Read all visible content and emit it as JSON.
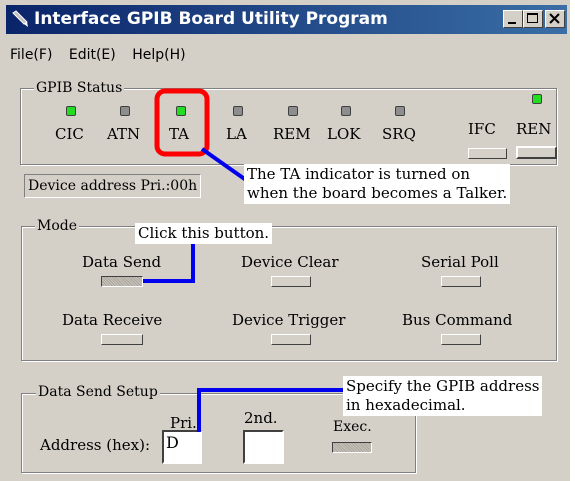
{
  "window": {
    "title": "Interface GPIB Board Utility Program",
    "icon": "pen-icon"
  },
  "menu": [
    "File(F)",
    "Edit(E)",
    "Help(H)"
  ],
  "gpib_status": {
    "title": "GPIB Status",
    "indicators": [
      {
        "label": "CIC",
        "state": "on"
      },
      {
        "label": "ATN",
        "state": "off"
      },
      {
        "label": "TA",
        "state": "on"
      },
      {
        "label": "LA",
        "state": "off"
      },
      {
        "label": "REM",
        "state": "off"
      },
      {
        "label": "LOK",
        "state": "off"
      },
      {
        "label": "SRQ",
        "state": "off"
      },
      {
        "label": "REN",
        "state": "on"
      }
    ],
    "buttons": {
      "ifc": "IFC",
      "ren": "REN"
    }
  },
  "device_address": "Device address Pri.:00h",
  "mode": {
    "title": "Mode",
    "buttons": [
      "Data Send",
      "Device Clear",
      "Serial Poll",
      "Data Receive",
      "Device Trigger",
      "Bus Command"
    ]
  },
  "data_send_setup": {
    "title": "Data Send Setup",
    "pri_label": "Pri.",
    "second_label": "2nd.",
    "exec_label": "Exec.",
    "address_label": "Address (hex):",
    "pri_value": "D",
    "second_value": ""
  },
  "callouts": {
    "ta_line1": "The TA indicator is turned on",
    "ta_line2": "when the board becomes a Talker.",
    "click": "Click this button.",
    "address_line1": "Specify the GPIB address",
    "address_line2": "in hexadecimal."
  },
  "colors": {
    "led_on": "#22dd22",
    "led_off": "#8e8e8e",
    "highlight_box": "#ff0000",
    "pointer_line": "#0000ee"
  }
}
